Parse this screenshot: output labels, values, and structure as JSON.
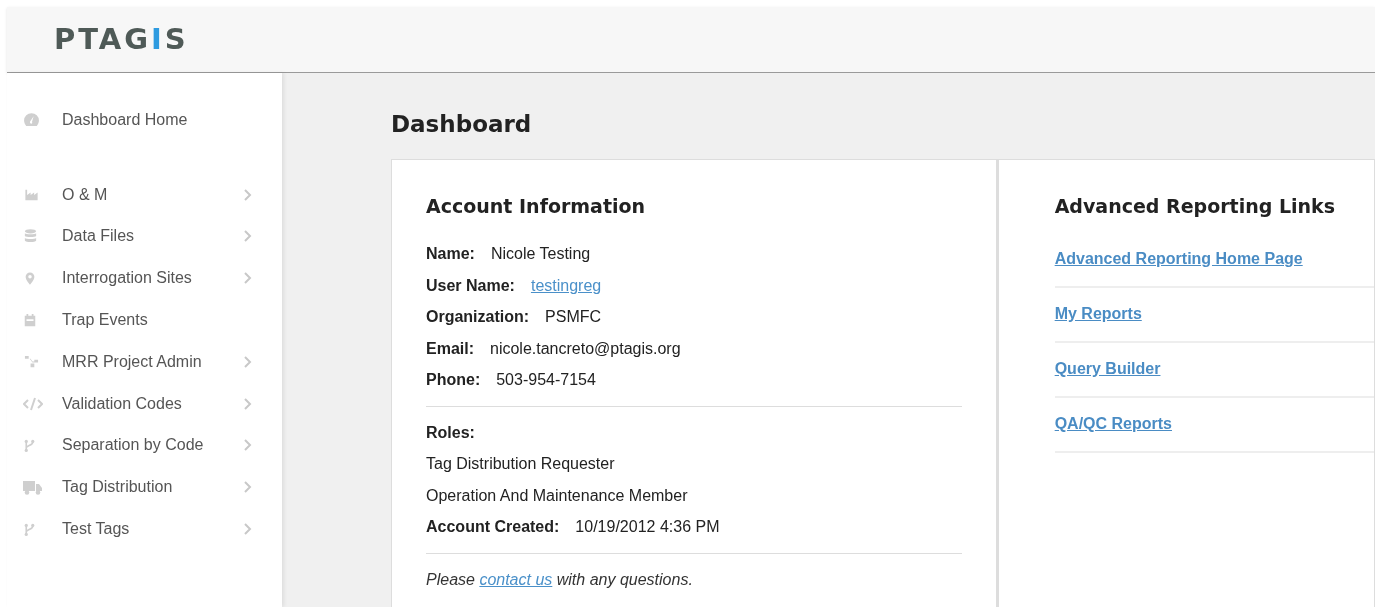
{
  "logo": {
    "parts": [
      {
        "text": "PTAG",
        "accent": false
      },
      {
        "text": "I",
        "accent": true
      },
      {
        "text": "S",
        "accent": false
      }
    ]
  },
  "sidebar": {
    "items": [
      {
        "label": "Dashboard Home",
        "has_submenu": false
      },
      {
        "label": "O & M",
        "has_submenu": true
      },
      {
        "label": "Data Files",
        "has_submenu": true
      },
      {
        "label": "Interrogation Sites",
        "has_submenu": true
      },
      {
        "label": "Trap Events",
        "has_submenu": false
      },
      {
        "label": "MRR Project Admin",
        "has_submenu": true
      },
      {
        "label": "Validation Codes",
        "has_submenu": true
      },
      {
        "label": "Separation by Code",
        "has_submenu": true
      },
      {
        "label": "Tag Distribution",
        "has_submenu": true
      },
      {
        "label": "Test Tags",
        "has_submenu": true
      }
    ]
  },
  "page_title": "Dashboard",
  "account": {
    "title": "Account Information",
    "fields": [
      {
        "label": "Name:",
        "value": "Nicole Testing",
        "kind": "text"
      },
      {
        "label": "User Name:",
        "value": "testingreg",
        "kind": "link"
      },
      {
        "label": "Organization:",
        "value": "PSMFC",
        "kind": "text"
      },
      {
        "label": "Email:",
        "value": "nicole.tancreto@ptagis.org",
        "kind": "text"
      },
      {
        "label": "Phone:",
        "value": "503-954-7154",
        "kind": "text"
      }
    ],
    "roles_label": "Roles:",
    "roles": [
      "Tag Distribution Requester",
      "Operation And Maintenance Member"
    ],
    "created": {
      "label": "Account Created:",
      "value": "10/19/2012 4:36 PM"
    },
    "note": {
      "before": "Please ",
      "link": "contact us",
      "after": " with any questions."
    }
  },
  "reporting": {
    "title": "Advanced Reporting Links",
    "links": [
      "Advanced Reporting Home Page",
      "My Reports",
      "Query Builder",
      "QA/QC Reports"
    ]
  }
}
